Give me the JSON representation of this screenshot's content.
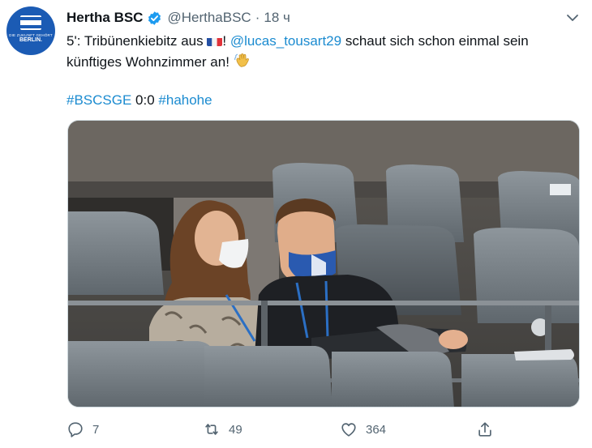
{
  "account": {
    "display_name": "Hertha BSC",
    "handle": "@HerthaBSC",
    "separator": "·",
    "time": "18 ч",
    "avatar_tagline": "DIE ZUKUNFT GEHÖRT",
    "avatar_city": "BERLIN."
  },
  "tweet": {
    "text_part1": "5': Tribünenkiebitz aus ",
    "text_part2": "! ",
    "mention": "@lucas_tousart29",
    "text_part3": " schaut sich schon einmal sein künftiges Wohnzimmer an! ",
    "hashtag1": "#BSCSGE",
    "score": " 0:0 ",
    "hashtag2": "#hahohe"
  },
  "actions": {
    "replies": "7",
    "retweets": "49",
    "likes": "364"
  },
  "colors": {
    "link": "#1b8bd0",
    "verified": "#1d9bf0",
    "secondary_text": "#536471",
    "club_blue": "#1b5bb4"
  },
  "icons": {
    "verified": "verified-badge-icon",
    "more": "chevron-down-icon",
    "reply": "reply-icon",
    "retweet": "retweet-icon",
    "like": "heart-icon",
    "share": "share-icon"
  }
}
